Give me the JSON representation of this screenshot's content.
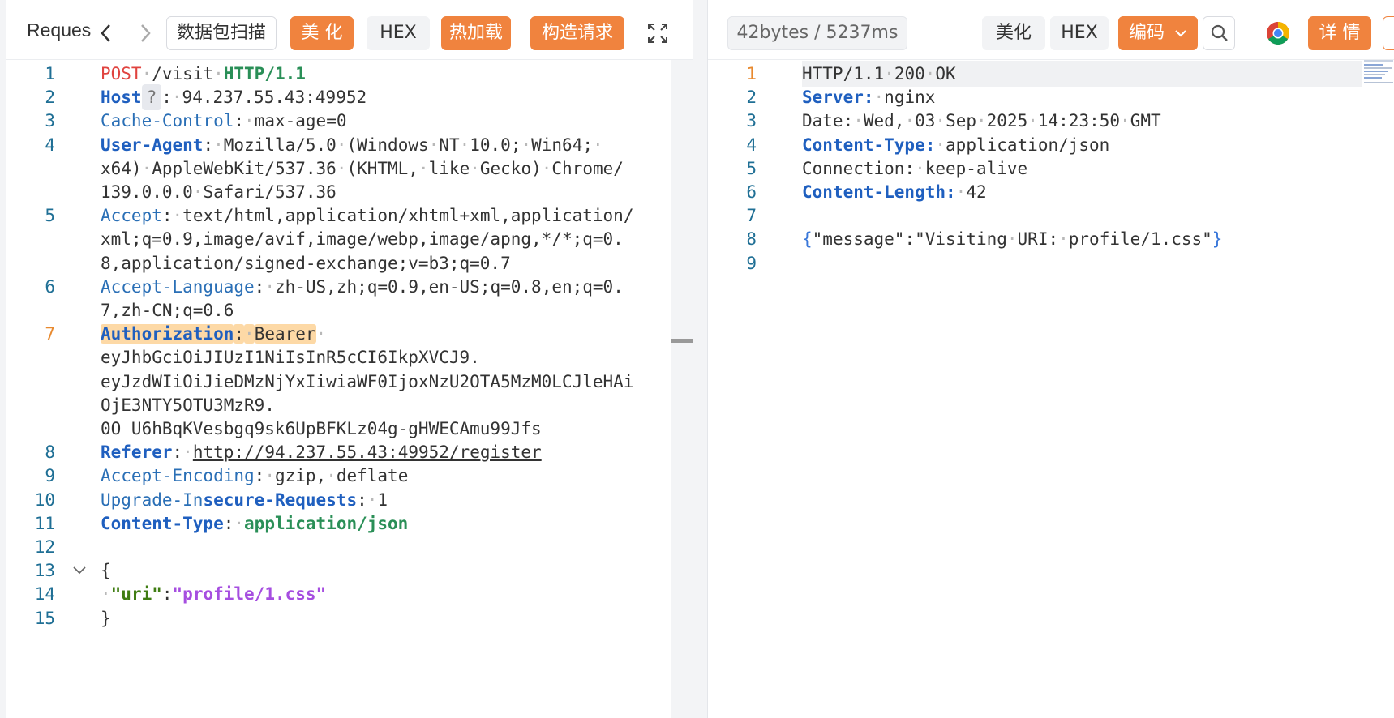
{
  "request_panel": {
    "title": "Reques",
    "buttons": {
      "scan": "数据包扫描",
      "beautify": "美 化",
      "hex": "HEX",
      "hot_load": "热加载",
      "construct": "构造请求"
    },
    "lines": [
      {
        "n": "1",
        "parts": [
          [
            "POST",
            "m"
          ],
          [
            "·",
            "dot"
          ],
          [
            "/visit",
            "sv"
          ],
          [
            "·",
            "dot"
          ],
          [
            "HTTP/1.1",
            "g"
          ]
        ]
      },
      {
        "n": "2",
        "parts": [
          [
            "Host",
            "k"
          ],
          [
            "?",
            "q"
          ],
          [
            ":",
            "sv"
          ],
          [
            "·",
            "dot"
          ],
          [
            "94.237.55.43:49952",
            "sv"
          ]
        ]
      },
      {
        "n": "3",
        "parts": [
          [
            "Cache-Control",
            "kn"
          ],
          [
            ":",
            "sv"
          ],
          [
            "·",
            "dot"
          ],
          [
            "max-age=0",
            "sv"
          ]
        ]
      },
      {
        "n": "4",
        "parts": [
          [
            "User-Agent",
            "k"
          ],
          [
            ":",
            "sv"
          ],
          [
            "·",
            "dot"
          ],
          [
            "Mozilla/5.0",
            "sv"
          ],
          [
            "·",
            "dot"
          ],
          [
            "(Windows",
            "sv"
          ],
          [
            "·",
            "dot"
          ],
          [
            "NT",
            "sv"
          ],
          [
            "·",
            "dot"
          ],
          [
            "10.0;",
            "sv"
          ],
          [
            "·",
            "dot"
          ],
          [
            "Win64;",
            "sv"
          ],
          [
            "·",
            "dot"
          ]
        ]
      },
      {
        "n": "",
        "parts": [
          [
            "x64)",
            "sv"
          ],
          [
            "·",
            "dot"
          ],
          [
            "AppleWebKit/537.36",
            "sv"
          ],
          [
            "·",
            "dot"
          ],
          [
            "(KHTML,",
            "sv"
          ],
          [
            "·",
            "dot"
          ],
          [
            "like",
            "sv"
          ],
          [
            "·",
            "dot"
          ],
          [
            "Gecko)",
            "sv"
          ],
          [
            "·",
            "dot"
          ],
          [
            "Chrome/",
            "sv"
          ]
        ]
      },
      {
        "n": "",
        "parts": [
          [
            "139.0.0.0",
            "sv"
          ],
          [
            "·",
            "dot"
          ],
          [
            "Safari/537.36",
            "sv"
          ]
        ]
      },
      {
        "n": "5",
        "parts": [
          [
            "Accept",
            "kn"
          ],
          [
            ":",
            "sv"
          ],
          [
            "·",
            "dot"
          ],
          [
            "text/html,application/xhtml+xml,application/",
            "sv"
          ]
        ]
      },
      {
        "n": "",
        "parts": [
          [
            "xml;q=0.9,image/avif,image/webp,image/apng,*/*;q=0.",
            "sv"
          ]
        ]
      },
      {
        "n": "",
        "parts": [
          [
            "8,application/signed-exchange;v=b3;q=0.7",
            "sv"
          ]
        ]
      },
      {
        "n": "6",
        "parts": [
          [
            "Accept-Language",
            "kn"
          ],
          [
            ":",
            "sv"
          ],
          [
            "·",
            "dot"
          ],
          [
            "zh-US,zh;q=0.9,en-US;q=0.8,en;q=0.",
            "sv"
          ]
        ]
      },
      {
        "n": "",
        "parts": [
          [
            "7,zh-CN;q=0.6",
            "sv"
          ]
        ]
      },
      {
        "n": "7",
        "hl": true,
        "parts": [
          [
            "Authorization",
            "khl"
          ],
          [
            ":",
            "svhl"
          ],
          [
            "·",
            "dothl"
          ],
          [
            "Bearer",
            "svhl"
          ],
          [
            "·",
            "dot"
          ]
        ]
      },
      {
        "n": "",
        "parts": [
          [
            "eyJhbGciOiJIUzI1NiIsInR5cCI6IkpXVCJ9.",
            "sv"
          ]
        ]
      },
      {
        "n": "",
        "parts": [
          [
            "eyJzdWIiOiJieDMzNjYxIiwiaWF0IjoxNzU2OTA5MzM0LCJleHAi",
            "sv"
          ]
        ]
      },
      {
        "n": "",
        "parts": [
          [
            "OjE3NTY5OTU3MzR9.",
            "sv"
          ]
        ]
      },
      {
        "n": "",
        "parts": [
          [
            "0O_U6hBqKVesbgq9sk6UpBFKLz04g-gHWECAmu99Jfs",
            "sv"
          ]
        ]
      },
      {
        "n": "8",
        "parts": [
          [
            "Referer",
            "k"
          ],
          [
            ":",
            "sv"
          ],
          [
            "·",
            "dot"
          ],
          [
            "http://94.237.55.43:49952/register",
            "su"
          ]
        ]
      },
      {
        "n": "9",
        "parts": [
          [
            "Accept-Encoding",
            "kn"
          ],
          [
            ":",
            "sv"
          ],
          [
            "·",
            "dot"
          ],
          [
            "gzip,",
            "sv"
          ],
          [
            "·",
            "dot"
          ],
          [
            "deflate",
            "sv"
          ]
        ]
      },
      {
        "n": "10",
        "parts": [
          [
            "Upgrade-In",
            "kn"
          ],
          [
            "secure-Requests",
            "k"
          ],
          [
            ":",
            "sv"
          ],
          [
            "·",
            "dot"
          ],
          [
            "1",
            "sv"
          ]
        ]
      },
      {
        "n": "11",
        "parts": [
          [
            "Content-Type",
            "k"
          ],
          [
            ":",
            "sv"
          ],
          [
            "·",
            "dot"
          ],
          [
            "application/json",
            "g"
          ]
        ]
      },
      {
        "n": "12",
        "parts": []
      },
      {
        "n": "13",
        "fold": true,
        "parts": [
          [
            "{",
            "sv"
          ]
        ]
      },
      {
        "n": "14",
        "parts": [
          [
            "·",
            "dot"
          ],
          [
            "\"uri\"",
            "strk"
          ],
          [
            ":",
            "sv"
          ],
          [
            "\"profile/1.css\"",
            "strv"
          ]
        ]
      },
      {
        "n": "15",
        "parts": [
          [
            "}",
            "sv"
          ]
        ]
      }
    ]
  },
  "response_panel": {
    "stats": "42bytes / 5237ms",
    "buttons": {
      "beautify": "美化",
      "hex": "HEX",
      "encode": "编码",
      "details": "详 情"
    },
    "lines": [
      {
        "n": "1",
        "parts": [
          [
            "HTTP/1.1",
            "sv"
          ],
          [
            "·",
            "dot"
          ],
          [
            "200",
            "sv"
          ],
          [
            "·",
            "dot"
          ],
          [
            "OK",
            "sv"
          ]
        ]
      },
      {
        "n": "2",
        "parts": [
          [
            "Server:",
            "k"
          ],
          [
            "·",
            "dot"
          ],
          [
            "nginx",
            "sv"
          ]
        ]
      },
      {
        "n": "3",
        "parts": [
          [
            "Date:",
            "sv"
          ],
          [
            "·",
            "dot"
          ],
          [
            "Wed,",
            "sv"
          ],
          [
            "·",
            "dot"
          ],
          [
            "03",
            "sv"
          ],
          [
            "·",
            "dot"
          ],
          [
            "Sep",
            "sv"
          ],
          [
            "·",
            "dot"
          ],
          [
            "2025",
            "sv"
          ],
          [
            "·",
            "dot"
          ],
          [
            "14:23:50",
            "sv"
          ],
          [
            "·",
            "dot"
          ],
          [
            "GMT",
            "sv"
          ]
        ]
      },
      {
        "n": "4",
        "parts": [
          [
            "Content-Type:",
            "k"
          ],
          [
            "·",
            "dot"
          ],
          [
            "application/json",
            "sv"
          ]
        ]
      },
      {
        "n": "5",
        "parts": [
          [
            "Connection:",
            "sv"
          ],
          [
            "·",
            "dot"
          ],
          [
            "keep-alive",
            "sv"
          ]
        ]
      },
      {
        "n": "6",
        "parts": [
          [
            "Content-Length:",
            "k"
          ],
          [
            "·",
            "dot"
          ],
          [
            "42",
            "sv"
          ]
        ]
      },
      {
        "n": "7",
        "parts": []
      },
      {
        "n": "8",
        "parts": [
          [
            "{",
            "brace"
          ],
          [
            "\"message\":\"Visiting",
            "sv"
          ],
          [
            "·",
            "dot"
          ],
          [
            "URI:",
            "sv"
          ],
          [
            "·",
            "dot"
          ],
          [
            "profile/1.css\"",
            "sv"
          ],
          [
            "}",
            "brace"
          ]
        ]
      },
      {
        "n": "9",
        "parts": []
      }
    ]
  },
  "colors": {
    "accent": "#f0833e",
    "key": "#1f5fbf",
    "method": "#e0433f",
    "green": "#2a8f57",
    "purple": "#a64ee0"
  }
}
